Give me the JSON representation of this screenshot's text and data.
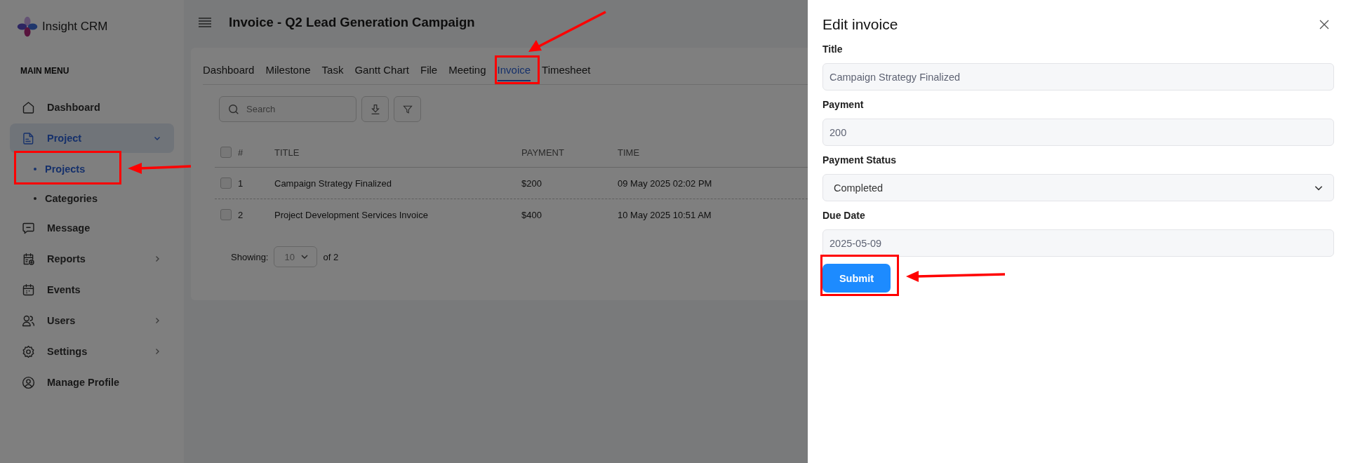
{
  "app": {
    "name": "Insight CRM"
  },
  "sidebar": {
    "heading": "MAIN MENU",
    "items": [
      {
        "kind": "link",
        "label": "Dashboard",
        "selected": false
      },
      {
        "kind": "group",
        "label": "Project",
        "selected": true,
        "expanded": true,
        "children": [
          {
            "label": "Projects",
            "selected": true
          },
          {
            "label": "Categories",
            "selected": false
          }
        ]
      },
      {
        "kind": "link",
        "label": "Message",
        "selected": false
      },
      {
        "kind": "group",
        "label": "Reports",
        "selected": false,
        "expanded": false
      },
      {
        "kind": "link",
        "label": "Events",
        "selected": false
      },
      {
        "kind": "group",
        "label": "Users",
        "selected": false,
        "expanded": false
      },
      {
        "kind": "group",
        "label": "Settings",
        "selected": false,
        "expanded": false
      },
      {
        "kind": "link",
        "label": "Manage Profile",
        "selected": false
      }
    ]
  },
  "header": {
    "title": "Invoice - Q2 Lead Generation Campaign"
  },
  "tabs": [
    {
      "label": "Dashboard",
      "selected": false
    },
    {
      "label": "Milestone",
      "selected": false
    },
    {
      "label": "Task",
      "selected": false
    },
    {
      "label": "Gantt Chart",
      "selected": false
    },
    {
      "label": "File",
      "selected": false
    },
    {
      "label": "Meeting",
      "selected": false
    },
    {
      "label": "Invoice",
      "selected": true
    },
    {
      "label": "Timesheet",
      "selected": false
    }
  ],
  "search": {
    "placeholder": "Search"
  },
  "table": {
    "all_checked": false,
    "columns": [
      "#",
      "TITLE",
      "PAYMENT",
      "TIME"
    ],
    "rows": [
      {
        "checked": false,
        "cells": [
          "1",
          "Campaign Strategy Finalized",
          "$200",
          "09 May 2025 02:02 PM"
        ]
      },
      {
        "checked": false,
        "cells": [
          "2",
          "Project Development Services Invoice",
          "$400",
          "10 May 2025 10:51 AM"
        ]
      }
    ]
  },
  "pagination": {
    "label": "Showing:",
    "page_size": "10",
    "total": "of 2"
  },
  "drawer": {
    "title": "Edit invoice",
    "fields": [
      {
        "kind": "text",
        "label": "Title",
        "value": "Campaign Strategy Finalized"
      },
      {
        "kind": "text",
        "label": "Payment",
        "value": "200"
      },
      {
        "kind": "select",
        "label": "Payment Status",
        "value": "Completed"
      },
      {
        "kind": "text",
        "label": "Due Date",
        "value": "2025-05-09"
      }
    ],
    "submit": "Submit"
  }
}
